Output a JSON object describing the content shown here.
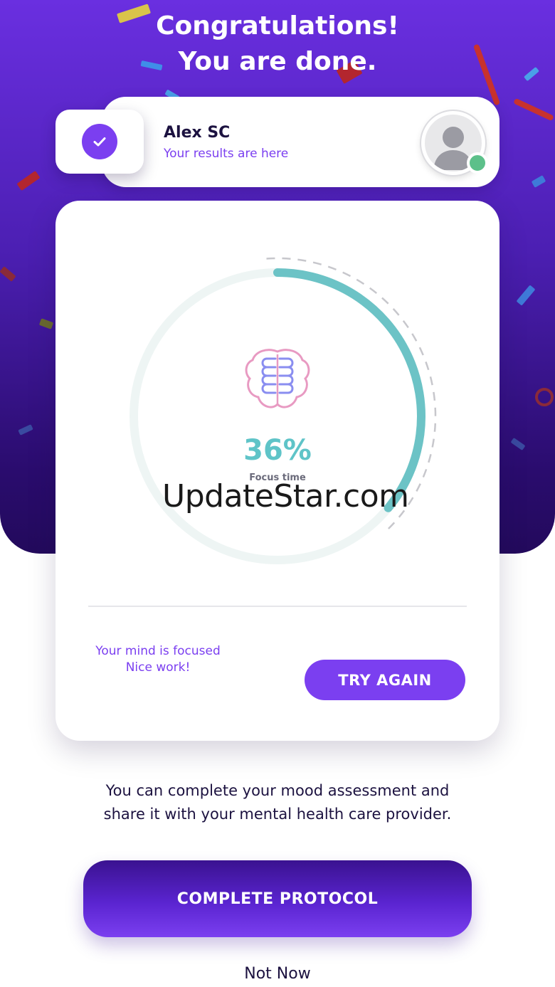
{
  "header": {
    "title_line1": "Congratulations!",
    "title_line2": "You are done."
  },
  "user": {
    "name": "Alex SC",
    "subtitle": "Your results are here",
    "status": "online"
  },
  "result": {
    "percent": "36%",
    "percent_value": 0.36,
    "label": "Focus time",
    "message_line1": "Your mind is focused",
    "message_line2": "Nice work!",
    "try_again_label": "TRY AGAIN"
  },
  "watermark": "UpdateStar.com",
  "info": {
    "line1": "You can complete your mood assessment and",
    "line2": "share it with your mental health care provider."
  },
  "actions": {
    "complete_label": "COMPLETE PROTOCOL",
    "not_now_label": "Not Now"
  },
  "colors": {
    "accent": "#7b3ff0",
    "gauge": "#5fc4c8",
    "online": "#5cc08a"
  },
  "icons": {
    "check": "check-icon",
    "avatar": "user-avatar-icon",
    "brain": "brain-icon"
  }
}
